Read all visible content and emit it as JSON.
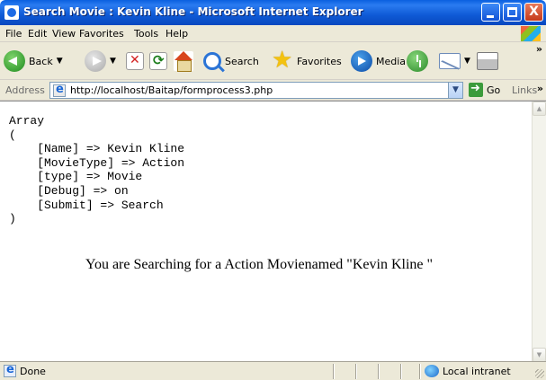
{
  "window": {
    "title": "Search Movie : Kevin Kline - Microsoft Internet Explorer",
    "close_glyph": "X"
  },
  "menu": {
    "items": [
      "File",
      "Edit",
      "View",
      "Favorites",
      "Tools",
      "Help"
    ]
  },
  "toolbar": {
    "back_label": "Back",
    "search_label": "Search",
    "favorites_label": "Favorites",
    "media_label": "Media",
    "overflow_glyph": "»"
  },
  "address": {
    "label": "Address",
    "url": "http://localhost/Baitap/formprocess3.php",
    "go_label": "Go",
    "links_label": "Links",
    "links_chevron": "»"
  },
  "content": {
    "array_dump": "Array\n(\n    [Name] => Kevin Kline\n    [MovieType] => Action\n    [type] => Movie\n    [Debug] => on\n    [Submit] => Search\n)",
    "message": "You are Searching for a Action Movienamed \"Kevin Kline \""
  },
  "status": {
    "text": "Done",
    "zone": "Local intranet"
  }
}
